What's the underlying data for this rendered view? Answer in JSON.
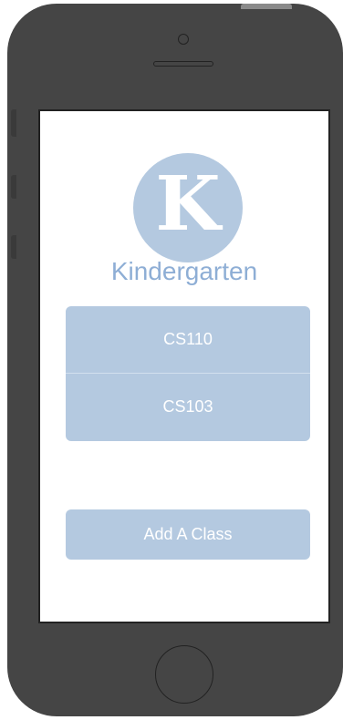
{
  "app": {
    "logo_letter": "K",
    "title": "Kindergarten"
  },
  "classes": [
    {
      "label": "CS110"
    },
    {
      "label": "CS103"
    }
  ],
  "actions": {
    "add_class_label": "Add A Class"
  },
  "colors": {
    "accent": "#b4c9e0",
    "title_text": "#8eaed5",
    "phone_body": "#454545"
  }
}
